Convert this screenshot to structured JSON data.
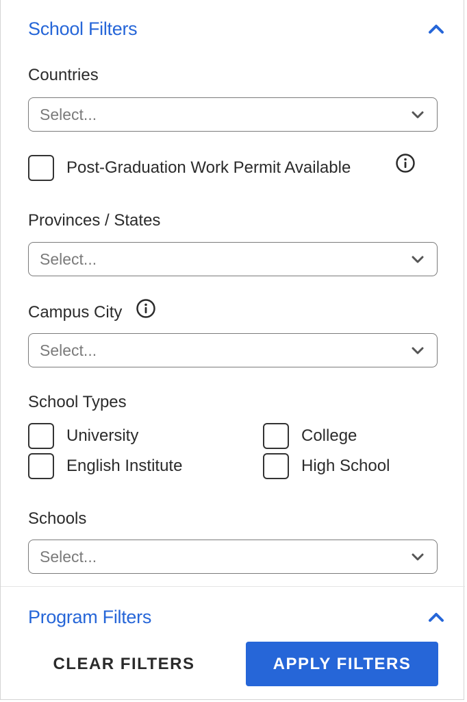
{
  "school_filters": {
    "title": "School Filters",
    "countries": {
      "label": "Countries",
      "placeholder": "Select..."
    },
    "pgwp": {
      "label": "Post-Graduation Work Permit Available",
      "checked": false
    },
    "provinces": {
      "label": "Provinces / States",
      "placeholder": "Select..."
    },
    "campus_city": {
      "label": "Campus City",
      "placeholder": "Select..."
    },
    "school_types": {
      "label": "School Types",
      "options": [
        {
          "label": "University",
          "checked": false
        },
        {
          "label": "College",
          "checked": false
        },
        {
          "label": "English Institute",
          "checked": false
        },
        {
          "label": "High School",
          "checked": false
        }
      ]
    },
    "schools": {
      "label": "Schools",
      "placeholder": "Select..."
    }
  },
  "program_filters": {
    "title": "Program Filters"
  },
  "actions": {
    "clear_label": "CLEAR FILTERS",
    "apply_label": "APPLY FILTERS"
  },
  "colors": {
    "accent": "#2666d8",
    "text": "#2b2b2b",
    "placeholder": "#7a7a7a",
    "border": "#7a7a7a"
  }
}
